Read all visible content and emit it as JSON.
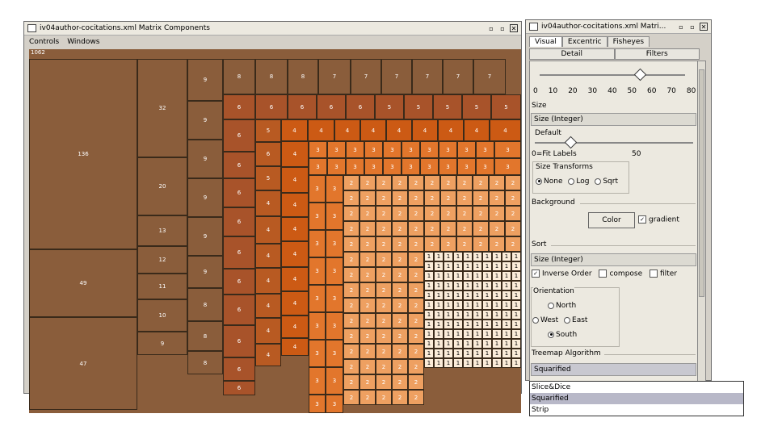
{
  "main_window": {
    "title": "iv04author-cocitations.xml Matrix Components",
    "menu": [
      "Controls",
      "Windows"
    ],
    "buttons": {
      "minimize": "▫",
      "maximize": "▫",
      "close": "✕"
    }
  },
  "treemap": {
    "root_label": "1062",
    "col1": [
      136,
      49,
      47
    ],
    "col2": [
      32,
      20,
      13,
      12,
      11,
      10,
      9
    ],
    "col3": [
      9,
      9,
      9,
      9,
      9,
      9,
      8,
      8,
      8
    ],
    "row1": [
      8,
      8,
      8,
      7,
      7,
      7,
      7,
      7,
      7
    ],
    "row2": [
      6,
      6,
      6,
      6,
      5,
      5,
      5,
      5,
      5,
      5
    ],
    "col4": [
      6,
      6,
      6,
      6,
      6,
      6,
      6,
      6,
      6,
      6,
      6
    ],
    "col5": [
      5,
      6,
      5,
      4,
      4,
      4,
      4,
      4,
      4,
      4
    ],
    "row3": [
      4,
      4,
      4,
      4,
      4,
      4,
      4,
      4,
      4,
      4,
      4
    ],
    "col6": [
      4,
      4,
      4,
      4,
      4,
      4,
      4,
      4,
      4
    ],
    "row_threes": [
      3,
      3,
      3,
      3,
      3,
      3,
      3,
      3,
      3,
      3
    ],
    "col_threes": [
      3,
      3,
      3,
      3,
      3,
      3,
      3,
      3,
      3,
      3,
      3,
      3,
      3,
      3,
      3,
      3,
      3
    ],
    "twos_label": "2",
    "ones_label": "1"
  },
  "side_window": {
    "title": "iv04author-cocitations.xml Matri...",
    "tabs": [
      "Visual",
      "Excentric",
      "Fisheyes"
    ],
    "subtabs": [
      "Detail",
      "Filters"
    ],
    "scale_ticks": [
      "0",
      "10",
      "20",
      "30",
      "40",
      "50",
      "60",
      "70",
      "80"
    ],
    "size_label": "Size",
    "size_value": "Size (Integer)",
    "default_label": "Default",
    "fit_label": "0=Fit Labels",
    "fit_value": "50",
    "size_transforms_label": "Size Transforms",
    "transforms": [
      "None",
      "Log",
      "Sqrt"
    ],
    "background_label": "Background",
    "color_button": "Color",
    "gradient_label": "gradient",
    "sort_label": "Sort",
    "sort_value": "Size (Integer)",
    "inverse_order": "Inverse Order",
    "compose": "compose",
    "filter": "filter",
    "orientation_label": "Orientation",
    "orient_north": "North",
    "orient_west": "West",
    "orient_east": "East",
    "orient_south": "South",
    "algo_label": "Treemap Algorithm",
    "algo_value": "Squarified"
  },
  "dropdown": {
    "options": [
      "Slice&Dice",
      "Squarified",
      "Strip"
    ],
    "selected": "Squarified"
  },
  "colors": {
    "brown": "#8a5d3b",
    "orange_dark": "#cc5a14",
    "orange_mid": "#e2762c",
    "orange_light": "#eea061",
    "cream": "#fbecd9"
  }
}
